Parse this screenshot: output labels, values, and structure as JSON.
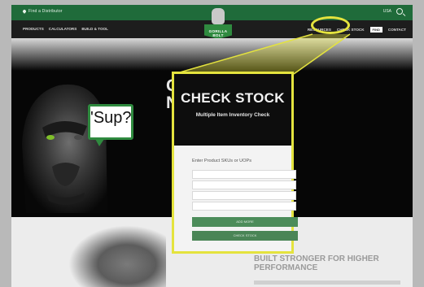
{
  "topbar": {
    "find_label": "Find a Distributor",
    "language": "USA"
  },
  "nav": {
    "left": [
      "PRODUCTS",
      "CALCULATORS",
      "BUILD & TOOL"
    ],
    "right": [
      "RESOURCES",
      "CHECK STOCK",
      "CONTACT"
    ],
    "lang_box": "FIND"
  },
  "logo_text": "GORILLA BOLT",
  "hero": {
    "headline_line1": "G",
    "headline_line2": "NO",
    "sup_text": "'Sup?"
  },
  "check_stock": {
    "title": "CHECK STOCK",
    "subtitle": "Multiple Item Inventory Check",
    "input_label": "Enter Product SKUs or UOPs",
    "buttons": [
      "ADD MORE",
      "CHECK STOCK"
    ]
  },
  "lower": {
    "heading": "BUILT STRONGER FOR HIGHER PERFORMANCE"
  },
  "colors": {
    "brand_green": "#1f6b3a",
    "highlight_yellow": "#e4e33e"
  }
}
